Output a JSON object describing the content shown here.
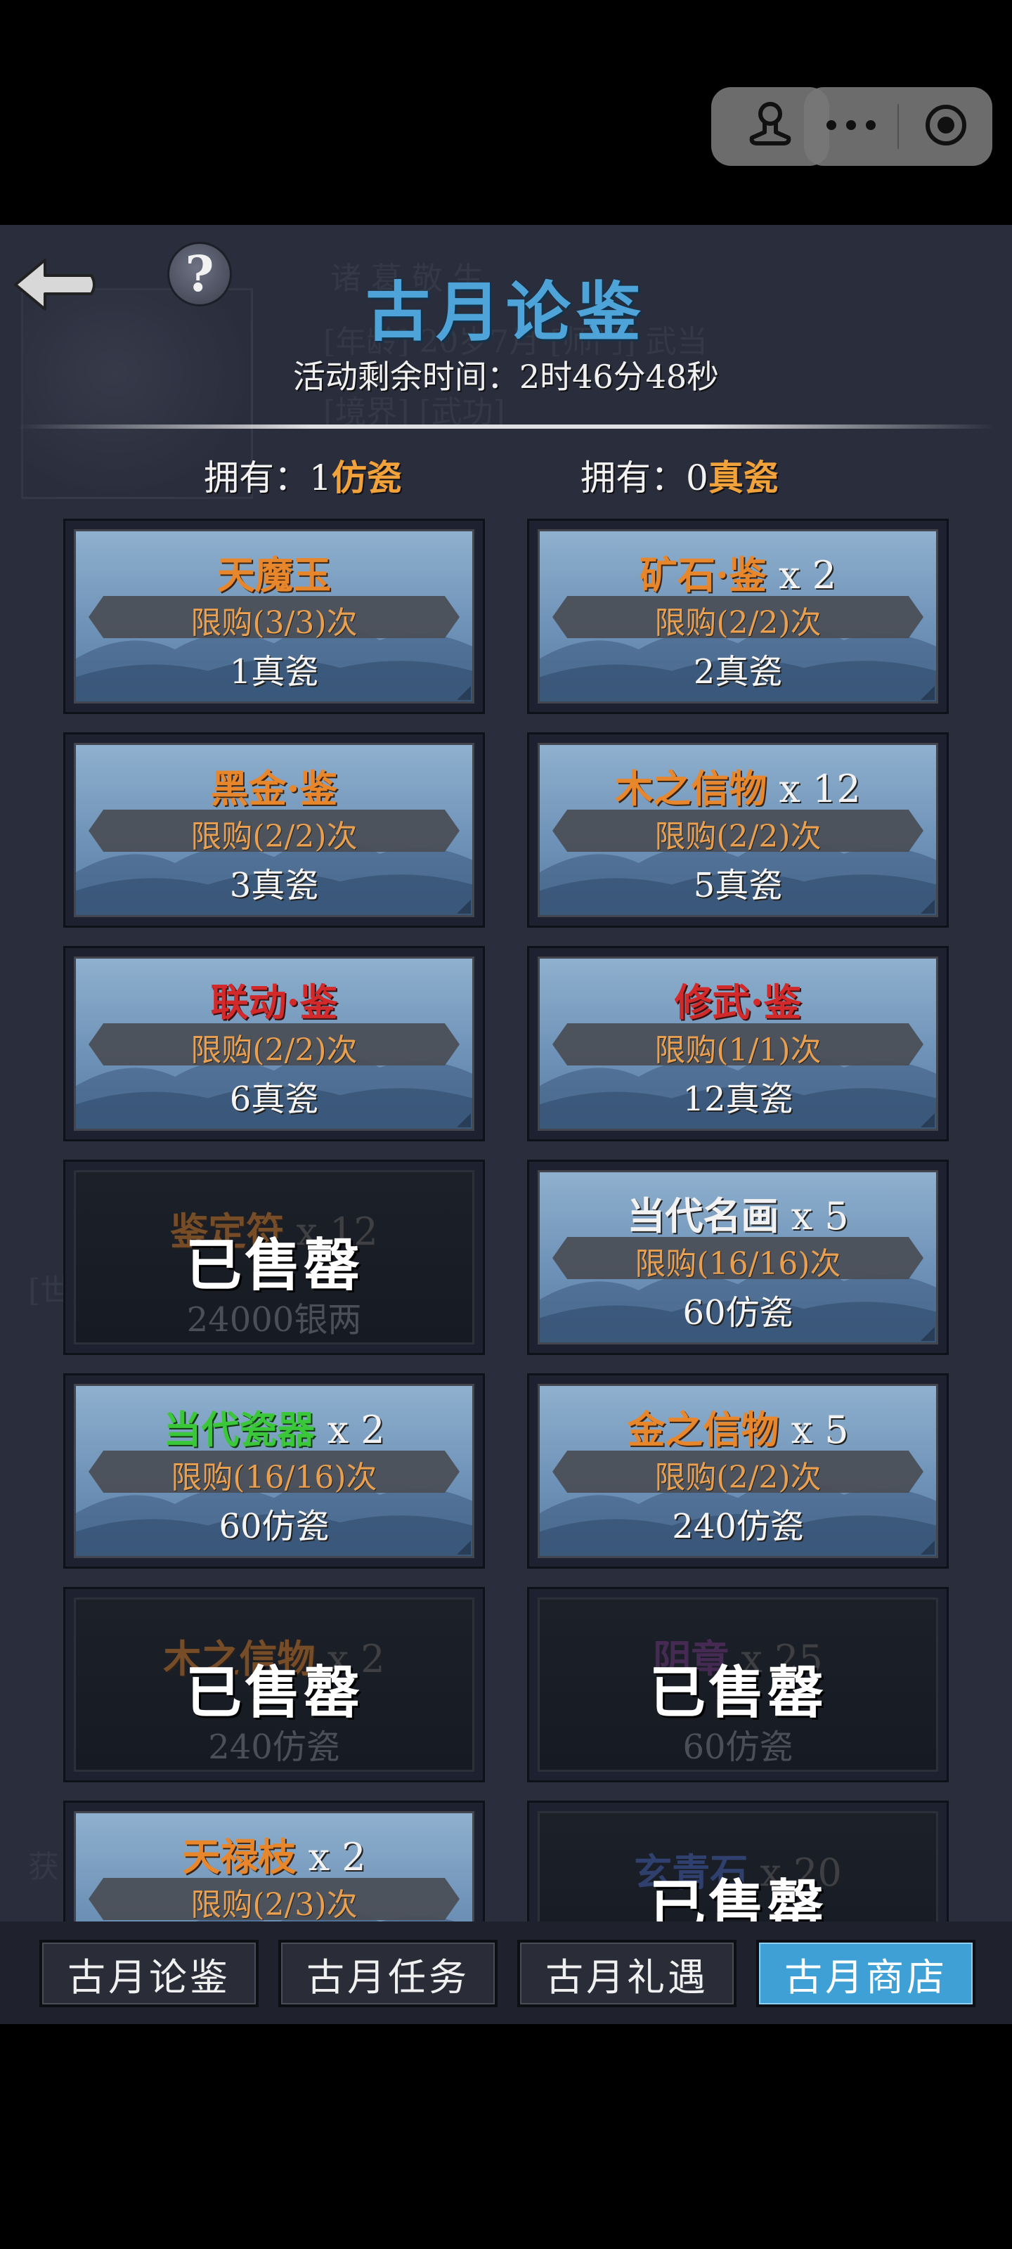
{
  "capsule": {
    "avatar_icon": "joystick-icon",
    "more_icon": "ellipsis-icon",
    "close_icon": "target-circle-icon"
  },
  "header": {
    "title": "古月论鉴",
    "timer": "活动剩余时间：2时46分48秒",
    "back_icon": "back-arrow-icon",
    "help_icon": "question-mark-icon",
    "help_glyph": "?"
  },
  "owned": {
    "fang": {
      "prefix": "拥有：",
      "count": "1",
      "currency": "仿瓷"
    },
    "zhen": {
      "prefix": "拥有：",
      "count": "0",
      "currency": "真瓷"
    }
  },
  "colors": {
    "title": "#4ea4d8",
    "orange": "#e8862c",
    "red": "#d22a2a",
    "green": "#3ac83a",
    "active_tab": "#3ea0d4"
  },
  "items": [
    {
      "name": "天魔玉",
      "qty": "",
      "name_color": "orange",
      "limit": "限购(3/3)次",
      "price": "1真瓷",
      "sold": false
    },
    {
      "name": "矿石·鉴",
      "qty": " x 2",
      "name_color": "orange",
      "limit": "限购(2/2)次",
      "price": "2真瓷",
      "sold": false
    },
    {
      "name": "黑金·鉴",
      "qty": "",
      "name_color": "orange",
      "limit": "限购(2/2)次",
      "price": "3真瓷",
      "sold": false
    },
    {
      "name": "木之信物",
      "qty": " x 12",
      "name_color": "orange",
      "limit": "限购(2/2)次",
      "price": "5真瓷",
      "sold": false
    },
    {
      "name": "联动·鉴",
      "qty": "",
      "name_color": "red",
      "limit": "限购(2/2)次",
      "price": "6真瓷",
      "sold": false
    },
    {
      "name": "修武·鉴",
      "qty": "",
      "name_color": "red",
      "limit": "限购(1/1)次",
      "price": "12真瓷",
      "sold": false
    },
    {
      "name": "鉴定符",
      "qty": " x 12",
      "name_color": "orange",
      "limit": "",
      "price": "24000银两",
      "sold": true
    },
    {
      "name": "当代名画",
      "qty": " x 5",
      "name_color": "white",
      "limit": "限购(16/16)次",
      "price": "60仿瓷",
      "sold": false
    },
    {
      "name": "当代瓷器",
      "qty": " x 2",
      "name_color": "green",
      "limit": "限购(16/16)次",
      "price": "60仿瓷",
      "sold": false
    },
    {
      "name": "金之信物",
      "qty": " x 5",
      "name_color": "orange",
      "limit": "限购(2/2)次",
      "price": "240仿瓷",
      "sold": false
    },
    {
      "name": "木之信物",
      "qty": " x 2",
      "name_color": "orange",
      "limit": "",
      "price": "240仿瓷",
      "sold": true
    },
    {
      "name": "阴章",
      "qty": " x 25",
      "name_color": "purple",
      "limit": "",
      "price": "60仿瓷",
      "sold": true
    },
    {
      "name": "天禄枝",
      "qty": " x 2",
      "name_color": "orange",
      "limit": "限购(2/3)次",
      "price": "",
      "sold": false
    },
    {
      "name": "玄青石",
      "qty": " x 20",
      "name_color": "blue",
      "limit": "",
      "price": "",
      "sold": true
    }
  ],
  "sold_out_label": "已售罄",
  "tabs": [
    {
      "label": "古月论鉴",
      "active": false
    },
    {
      "label": "古月任务",
      "active": false
    },
    {
      "label": "古月礼遇",
      "active": false
    },
    {
      "label": "古月商店",
      "active": true
    }
  ]
}
